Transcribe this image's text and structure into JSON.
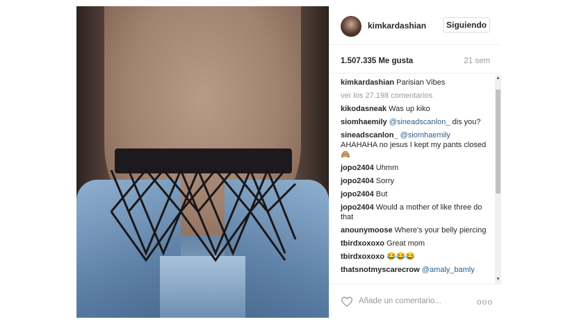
{
  "post": {
    "username": "kimkardashian",
    "follow_label": "Siguiendo",
    "likes": "1.507.335 Me gusta",
    "time_ago": "21 sem"
  },
  "caption": {
    "user": "kimkardashian",
    "text": "Parisian Vibes"
  },
  "view_comments": "ver los 27.198 comentarios",
  "comments": [
    {
      "user": "kikodasneak",
      "mention": "",
      "text": "Was up kiko"
    },
    {
      "user": "siomhaemily",
      "mention": "@sineadscanlon_",
      "text": "dis you?"
    },
    {
      "user": "sineadscanlon_",
      "mention": "@siomhaemily",
      "text": "AHAHAHA no jesus I kept my pants closed 🙈"
    },
    {
      "user": "jopo2404",
      "mention": "",
      "text": "Uhmm"
    },
    {
      "user": "jopo2404",
      "mention": "",
      "text": "Sorry"
    },
    {
      "user": "jopo2404",
      "mention": "",
      "text": "But"
    },
    {
      "user": "jopo2404",
      "mention": "",
      "text": "Would a mother of like three do that"
    },
    {
      "user": "anounymoose",
      "mention": "",
      "text": "Where's your belly piercing"
    },
    {
      "user": "tbirdxoxoxo",
      "mention": "",
      "text": "Great mom"
    },
    {
      "user": "tbirdxoxoxo",
      "mention": "",
      "text": "😂😂😂"
    },
    {
      "user": "thatsnotmyscarecrow",
      "mention": "@amaly_bamly",
      "text": ""
    }
  ],
  "footer": {
    "add_comment_placeholder": "Añade un comentario...",
    "options_glyph": "ooo"
  },
  "icons": {
    "like": "heart-icon",
    "options": "more-options-icon"
  }
}
